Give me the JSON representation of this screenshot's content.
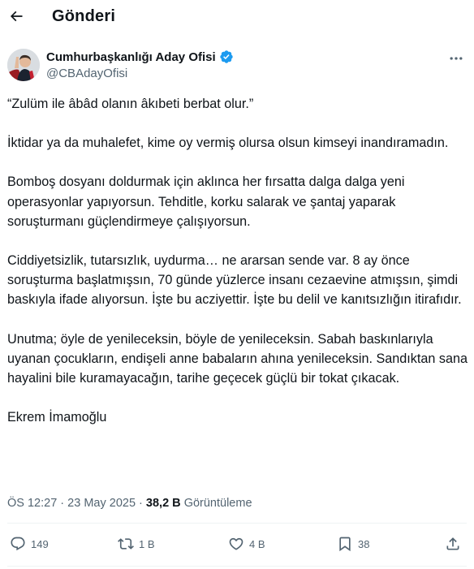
{
  "header": {
    "title": "Gönderi",
    "back_icon": "arrow-left-icon"
  },
  "author": {
    "display_name": "Cumhurbaşkanlığı Aday Ofisi",
    "handle": "@CBAdayOfisi",
    "verified": true,
    "verified_color": "#1d9bf0"
  },
  "tweet": {
    "paragraphs": [
      "“Zulüm ile âbâd olanın âkıbeti berbat olur.”",
      "İktidar ya da muhalefet, kime oy vermiş olursa olsun kimseyi inandıramadın.",
      "Bomboş dosyanı doldurmak için aklınca her fırsatta dalga dalga yeni operasyonlar yapıyorsun. Tehditle, korku salarak ve şantaj yaparak soruşturmanı güçlendirmeye çalışıyorsun.",
      "Ciddiyetsizlik, tutarsızlık, uydurma… ne ararsan sende var. 8 ay önce soruşturma başlatmışsın, 70 günde yüzlerce insanı cezaevine atmışsın, şimdi baskıyla ifade alıyorsun. İşte bu acziyettir. İşte bu delil ve kanıtsızlığın itirafıdır.",
      "Unutma; öyle de yenileceksin, böyle de yenileceksin. Sabah baskınlarıyla uyanan çocukların, endişeli anne babaların ahına yenileceksin. Sandıktan sana hayalini bile kuramayacağın, tarihe geçecek güçlü bir tokat çıkacak.",
      "Ekrem İmamoğlu"
    ]
  },
  "meta": {
    "time": "ÖS 12:27",
    "separator": "·",
    "date": "23 May 2025",
    "views_count": "38,2 B",
    "views_label": "Görüntüleme"
  },
  "actions": {
    "reply": {
      "icon": "reply-icon",
      "count": "149"
    },
    "retweet": {
      "icon": "retweet-icon",
      "count": "1 B"
    },
    "like": {
      "icon": "heart-icon",
      "count": "4 B"
    },
    "bookmark": {
      "icon": "bookmark-icon",
      "count": "38"
    },
    "share": {
      "icon": "share-icon"
    }
  }
}
